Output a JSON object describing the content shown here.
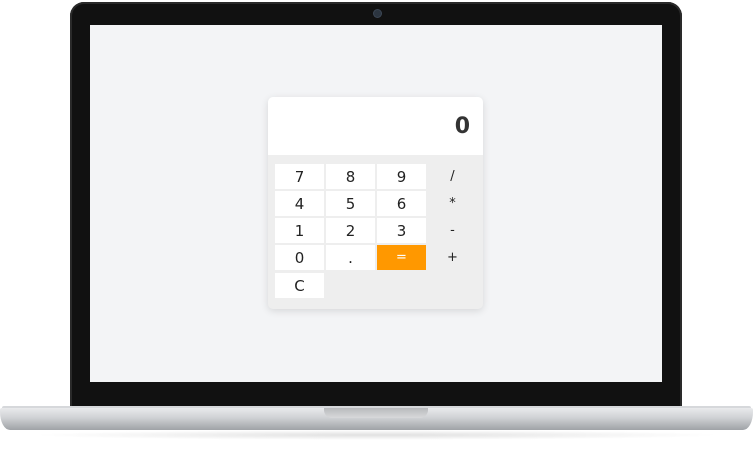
{
  "calculator": {
    "display": "0",
    "keys": {
      "k7": "7",
      "k8": "8",
      "k9": "9",
      "div": "/",
      "k4": "4",
      "k5": "5",
      "k6": "6",
      "mul": "*",
      "k1": "1",
      "k2": "2",
      "k3": "3",
      "sub": "-",
      "k0": "0",
      "dot": ".",
      "eq": "=",
      "add": "+",
      "clear": "C"
    },
    "accent_color": "#ff9800"
  }
}
